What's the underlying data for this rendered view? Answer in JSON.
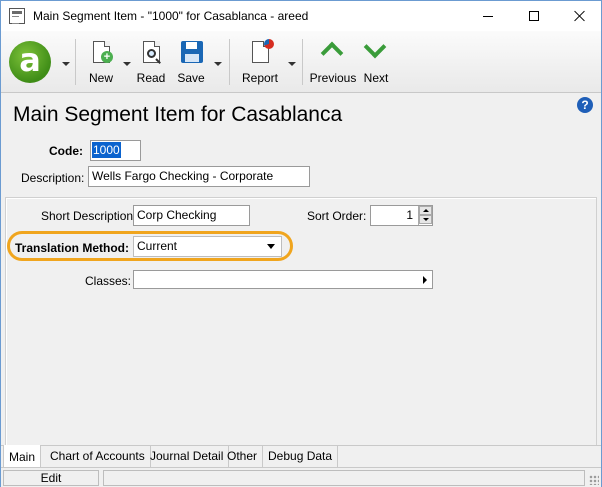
{
  "window": {
    "title": "Main Segment Item - \"1000\" for Casablanca - areed"
  },
  "toolbar": {
    "logo_letter": "a",
    "buttons": [
      {
        "id": "new",
        "label": "New",
        "icon": "new-document-icon"
      },
      {
        "id": "read",
        "label": "Read",
        "icon": "read-magnifier-icon"
      },
      {
        "id": "save",
        "label": "Save",
        "icon": "save-floppy-icon"
      },
      {
        "id": "report",
        "label": "Report",
        "icon": "report-chart-icon"
      },
      {
        "id": "previous",
        "label": "Previous",
        "icon": "chevron-up-icon"
      },
      {
        "id": "next",
        "label": "Next",
        "icon": "chevron-down-icon"
      }
    ]
  },
  "page": {
    "title": "Main Segment Item for Casablanca",
    "help_glyph": "?"
  },
  "form": {
    "code_label": "Code:",
    "code_value": "1000",
    "description_label": "Description:",
    "description_value": "Wells Fargo Checking - Corporate",
    "short_description_label": "Short Description:",
    "short_description_value": "Corp Checking",
    "sort_order_label": "Sort Order:",
    "sort_order_value": "1",
    "translation_method_label": "Translation Method:",
    "translation_method_value": "Current",
    "classes_label": "Classes:",
    "classes_value": ""
  },
  "tabs": [
    {
      "label": "Main",
      "active": true
    },
    {
      "label": "Chart of Accounts",
      "active": false
    },
    {
      "label": "Journal Detail",
      "active": false
    },
    {
      "label": "Other",
      "active": false
    },
    {
      "label": "Debug Data",
      "active": false
    }
  ],
  "status": {
    "mode": "Edit"
  },
  "colors": {
    "highlight": "#f0a51e",
    "brand_green": "#3f8d17",
    "selection_blue": "#0b63ce"
  }
}
